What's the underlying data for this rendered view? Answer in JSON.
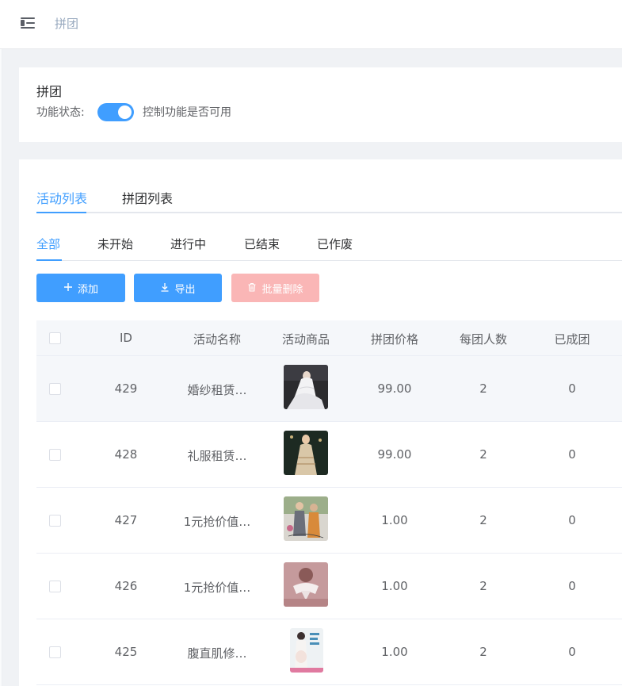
{
  "header": {
    "menu_icon": "hamburger-fold-icon",
    "breadcrumb": "拼团"
  },
  "feature_card": {
    "title": "拼团",
    "status_label": "功能状态:",
    "switch_on": true,
    "switch_description": "控制功能是否可用",
    "accent_color": "#409eff"
  },
  "tabs": [
    {
      "label": "活动列表",
      "active": true
    },
    {
      "label": "拼团列表",
      "active": false
    }
  ],
  "sub_tabs": [
    {
      "label": "全部",
      "active": true
    },
    {
      "label": "未开始",
      "active": false
    },
    {
      "label": "进行中",
      "active": false
    },
    {
      "label": "已结束",
      "active": false
    },
    {
      "label": "已作废",
      "active": false
    }
  ],
  "toolbar": {
    "add_label": "添加",
    "add_icon": "plus-icon",
    "export_label": "导出",
    "export_icon": "download-icon",
    "delete_label": "批量删除",
    "delete_icon": "trash-icon",
    "delete_disabled": true,
    "delete_color": "#fab6b6"
  },
  "table": {
    "columns": [
      "ID",
      "活动名称",
      "活动商品",
      "拼团价格",
      "每团人数",
      "已成团"
    ],
    "rows": [
      {
        "id": "429",
        "name": "婚纱租赁…",
        "product_image": "wedding-dress-photo",
        "price": "99.00",
        "group_size": "2",
        "formed": "0"
      },
      {
        "id": "428",
        "name": "礼服租赁…",
        "product_image": "evening-gown-photo",
        "price": "99.00",
        "group_size": "2",
        "formed": "0"
      },
      {
        "id": "427",
        "name": "1元抢价值…",
        "product_image": "fashion-couple-photo",
        "price": "1.00",
        "group_size": "2",
        "formed": "0"
      },
      {
        "id": "426",
        "name": "1元抢价值…",
        "product_image": "pink-bow-photo",
        "price": "1.00",
        "group_size": "2",
        "formed": "0"
      },
      {
        "id": "425",
        "name": "腹直肌修…",
        "product_image": "maternity-poster-photo",
        "price": "1.00",
        "group_size": "2",
        "formed": "0"
      }
    ]
  }
}
